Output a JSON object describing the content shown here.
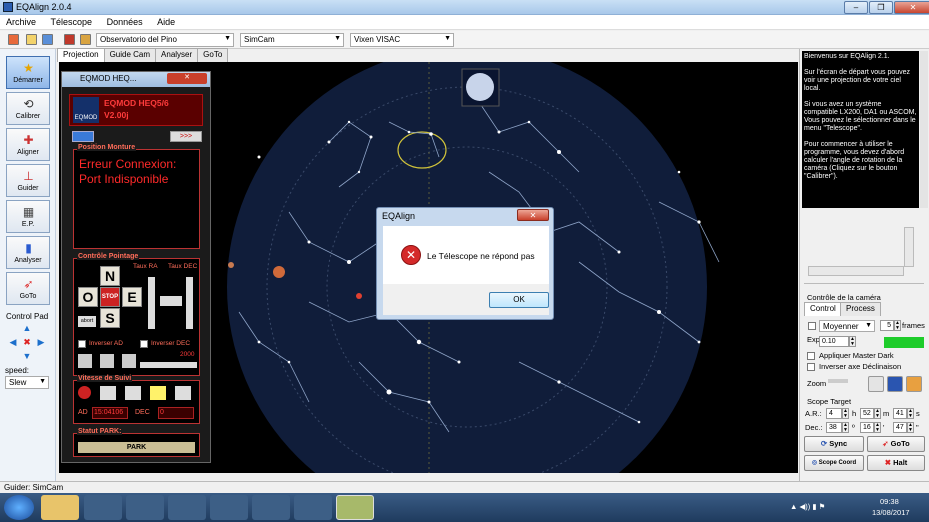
{
  "window": {
    "title": "EQAlign 2.0.4"
  },
  "menu": [
    "Archive",
    "Télescope",
    "Données",
    "Aide"
  ],
  "toolbar": {
    "site": "Observatorio del Pino",
    "camera": "SimCam",
    "mount": "Vixen VISAC"
  },
  "tabs": [
    "Projection",
    "Guide Cam",
    "Analyser",
    "GoTo"
  ],
  "sidebar": {
    "buttons": [
      {
        "label": "Démarrer",
        "icon": "star-icon"
      },
      {
        "label": "Calibrer",
        "icon": "rotate-icon"
      },
      {
        "label": "Aligner",
        "icon": "align-icon"
      },
      {
        "label": "Guider",
        "icon": "crosshair-icon"
      },
      {
        "label": "E.P.",
        "icon": "ep-icon"
      },
      {
        "label": "Analyser",
        "icon": "chart-icon"
      },
      {
        "label": "GoTo",
        "icon": "rocket-icon"
      }
    ],
    "control_pad": "Control Pad",
    "speed_label": "speed:",
    "speed_value": "Slew"
  },
  "eqmod": {
    "title": "EQMOD HEQ...",
    "mount_name": "EQMOD HEQ5/6",
    "version": "V2.00j",
    "logo": "EQMOD",
    "position_label": "Position Monture",
    "error_line1": "Erreur Connexion:",
    "error_line2": "Port Indisponible",
    "control_label": "Contrôle Pointage",
    "taux_ra": "Taux RA",
    "taux_dec": "Taux DEC",
    "n": "N",
    "s": "S",
    "e": "E",
    "o": "O",
    "stop": "STOP",
    "abort": "abort",
    "inverser_ad": "Inverser AD",
    "inverser_dec": "Inverser DEC",
    "rate_value": "2000",
    "tracking_label": "Vitesse de Suivi",
    "ad_label": "AD",
    "ad_value": "15:04106",
    "dec_label": "DEC",
    "dec_value": "0",
    "park_label": "Statut PARK:",
    "park_button": "PARK"
  },
  "dialog": {
    "title": "EQAlign",
    "message": "Le Télescope ne répond pas",
    "ok": "OK",
    "close_glyph": "✕"
  },
  "right": {
    "info_paragraphs": [
      "Bienvenus sur EQAlign 2.1.",
      "Sur l'écran de départ vous pouvez voir une projection de votre ciel local.",
      "Si vous avez un système compatible LX200, DA1 ou ASCOM, Vous pouvez le sélectionner dans le menu \"Telescope\".",
      "Pour commencer à utiliser le programme, vous devez d'abord calculer l'angle de rotation de la caméra (Cliquez sur le bouton \"Calibrer\")."
    ],
    "camera_section": "Contrôle de la caméra",
    "cam_tab_control": "Control",
    "cam_tab_process": "Process",
    "mode": "Moyenner",
    "frames_value": "5",
    "frames_label": "frames",
    "exposition_label": "Exposition",
    "exposition_value": "0.10",
    "master_dark": "Appliquer Master Dark",
    "invert_dec": "Inverser axe Déclinaison",
    "zoom": "Zoom",
    "scope_target": "Scope Target",
    "ar_label": "A.R.:",
    "ar_h": "4",
    "ar_h_unit": "h",
    "ar_m": "52",
    "ar_m_unit": "m",
    "ar_s": "41",
    "ar_s_unit": "s",
    "dec_label": "Dec.:",
    "dec_d": "38",
    "dec_d_unit": "º",
    "dec_m": "16",
    "dec_m_unit": "'",
    "dec_s": "47",
    "dec_s_unit": "\"",
    "sync": "Sync",
    "goto": "GoTo",
    "scope_coord": "Scope Coord",
    "halt": "Halt"
  },
  "status": "Guider: SimCam",
  "taskbar": {
    "time": "09:38",
    "date": "13/08/2017"
  }
}
